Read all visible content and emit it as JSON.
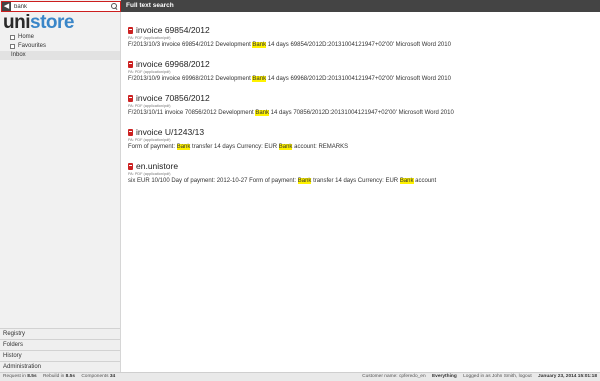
{
  "search": {
    "value": "bank",
    "placeholder": ""
  },
  "logo": {
    "part1": "uni",
    "part2": "store"
  },
  "sidebar": {
    "items": [
      {
        "label": "Home"
      },
      {
        "label": "Favourites"
      },
      {
        "label": "Inbox"
      }
    ],
    "bottom": [
      {
        "label": "Registry"
      },
      {
        "label": "Folders"
      },
      {
        "label": "History"
      },
      {
        "label": "Administration"
      }
    ]
  },
  "header": {
    "title": "Full text search"
  },
  "results": [
    {
      "title": "invoice 69854/2012",
      "type": "PA: PDF (application/pdf)",
      "pre": "F/2013/10/3 invoice 69854/2012 Development ",
      "hl": "Bank",
      "post": " 14 days 69854/2012D:20131004121947+02'00' Microsoft Word 2010"
    },
    {
      "title": "invoice 69968/2012",
      "type": "PA: PDF (application/pdf)",
      "pre": "F/2013/10/9 invoice 69968/2012 Development ",
      "hl": "Bank",
      "post": " 14 days 69968/2012D:20131004121947+02'00' Microsoft Word 2010"
    },
    {
      "title": "invoice 70856/2012",
      "type": "PA: PDF (application/pdf)",
      "pre": "F/2013/10/11 invoice 70856/2012 Development ",
      "hl": "Bank",
      "post": " 14 days 70856/2012D:20131004121947+02'00' Microsoft Word 2010"
    },
    {
      "title": "invoice U/1243/13",
      "type": "PA: PDF (application/pdf)",
      "pre": "Form of payment: ",
      "hl": "Bank",
      "mid": " transfer 14 days Currency: EUR ",
      "hl2": "Bank",
      "post": " account: REMARKS"
    },
    {
      "title": "en.unistore",
      "type": "PA: PDF (application/pdf)",
      "pre": "six EUR 10/100 Day of payment: 2012-10-27 Form of payment: ",
      "hl": "Bank",
      "mid": " transfer 14 days Currency: EUR ",
      "hl2": "Bank",
      "post": " account"
    }
  ],
  "status": {
    "request_label": "Request in",
    "request_value": "8.5s",
    "rebuild_label": "Rebuild in",
    "rebuild_value": "8.5s",
    "components_label": "Components",
    "components_value": "34",
    "customer_label": "Customer name:",
    "customer_value": "cpferedo_en",
    "scope": "Everything",
    "logged_label": "Logged in as",
    "user": "John Smith",
    "logout": "logout",
    "datetime": "January 23, 2014 15:01:18"
  },
  "colors": {
    "header_bg": "#444444",
    "highlight": "#fff200",
    "pdf_icon": "#cc2222",
    "search_border": "#cc1e1e",
    "logo_accent": "#3a86c8"
  }
}
